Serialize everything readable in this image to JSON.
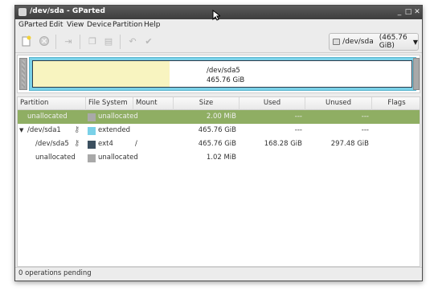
{
  "window": {
    "title": "/dev/sda - GParted"
  },
  "menubar": {
    "items": [
      "GParted",
      "Edit",
      "View",
      "Device",
      "Partition",
      "Help"
    ]
  },
  "toolbar": {
    "buttons": [
      "new-icon",
      "delete-icon",
      "resize-move-icon",
      "copy-icon",
      "paste-icon",
      "undo-icon",
      "apply-icon"
    ],
    "device": "/dev/sda",
    "device_size": "(465.76 GiB)"
  },
  "partition_map": {
    "name": "/dev/sda5",
    "size": "465.76 GiB",
    "used_fraction": 0.36
  },
  "table": {
    "headers": [
      "Partition",
      "File System",
      "Mount Point",
      "Size",
      "Used",
      "Unused",
      "Flags"
    ],
    "rows": [
      {
        "partition": "unallocated",
        "fs": "unallocated",
        "mount": "",
        "size": "2.00 MiB",
        "used": "---",
        "unused": "---",
        "flags": "",
        "selected": true
      },
      {
        "partition": "/dev/sda1",
        "fs": "extended",
        "mount": "",
        "size": "465.76 GiB",
        "used": "---",
        "unused": "---",
        "flags": ""
      },
      {
        "partition": "/dev/sda5",
        "fs": "ext4",
        "mount": "/",
        "size": "465.76 GiB",
        "used": "168.28 GiB",
        "unused": "297.48 GiB",
        "flags": ""
      },
      {
        "partition": "unallocated",
        "fs": "unallocated",
        "mount": "",
        "size": "1.02 MiB",
        "used": "",
        "unused": "",
        "flags": ""
      }
    ]
  },
  "status": {
    "text": "0 operations pending"
  },
  "colors": {
    "selection": "#8fae63",
    "unallocated": "#a9a9a9",
    "extended": "#7ad1e8",
    "ext4": "#3c5060",
    "used": "#f8f4c0"
  }
}
